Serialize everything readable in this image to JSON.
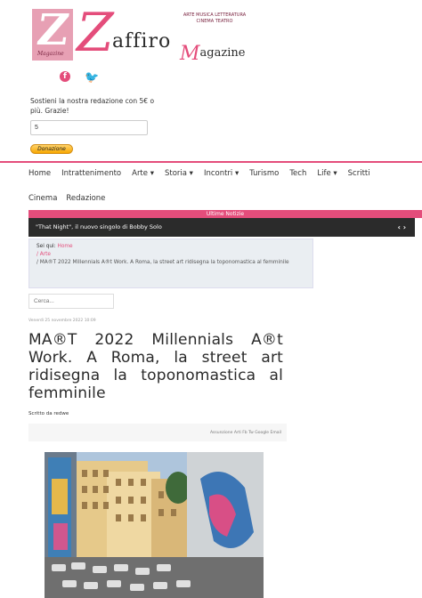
{
  "logo": {
    "box_small": "Magazine",
    "z": "Z",
    "word": "affiro",
    "mag_initial": "M",
    "mag_rest": "agazine",
    "tagline": "Arte Musica Letteratura Cinema Teatro"
  },
  "social": {
    "facebook": "f",
    "twitter": "🐦"
  },
  "donation": {
    "text": "Sostieni la nostra redazione con 5€ o più. Grazie!",
    "input_value": "5",
    "button_label": "Donazione"
  },
  "nav": {
    "items": [
      "Home",
      "Intrattenimento",
      "Arte ▾",
      "Storia ▾",
      "Incontri ▾",
      "Turismo",
      "Tech",
      "Life ▾",
      "Scritti"
    ],
    "row2": [
      "Cinema",
      "Redazione"
    ]
  },
  "ticker": {
    "heading": "Ultime Notizie",
    "headline": "\"That Night\", il nuovo singolo di Bobby Solo",
    "nav": "‹ ›"
  },
  "breadcrumb": {
    "label": "Sei qui:",
    "home": "Home",
    "section": "/ Arte",
    "current": "/ MA®T 2022 Millennials A®t Work. A Roma, la street art ridisegna la toponomastica al femminile"
  },
  "search": {
    "placeholder": "Cerca..."
  },
  "article": {
    "date": "Venerdì 25 novembre 2022 10:09",
    "title": "MA®T 2022 Millennials A®t Work. A Roma, la street art ridisegna la toponomastica al femminile",
    "author": "Scritto da redwe"
  },
  "share": {
    "text": "Assunzione Arti  Fb  Tw  Google  Email"
  },
  "colors": {
    "accent": "#e44d7b",
    "dark": "#2b2b2b"
  }
}
